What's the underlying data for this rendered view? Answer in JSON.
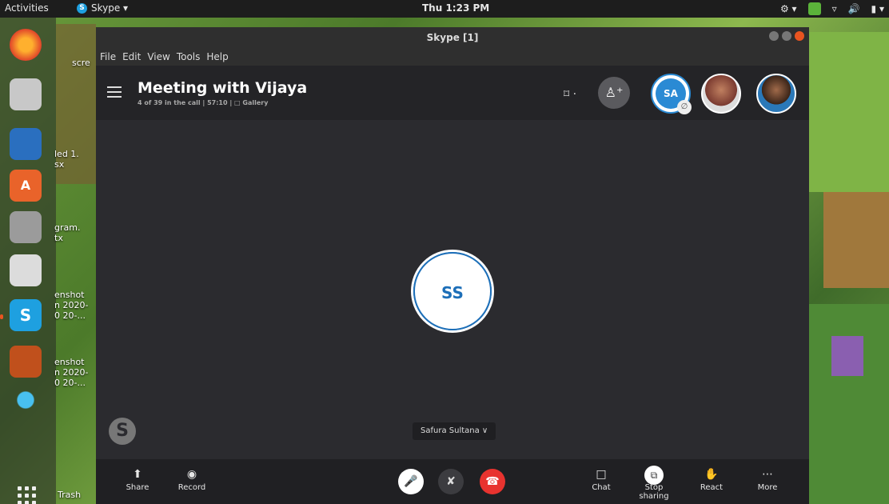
{
  "topbar": {
    "activities": "Activities",
    "app_name": "Skype ▾",
    "clock": "Thu  1:23 PM"
  },
  "desktop_files": [
    {
      "label": "scre"
    },
    {
      "label": "led 1.\nsx"
    },
    {
      "label": "gram.\ntx"
    },
    {
      "label": "enshot\nn 2020-\n0 20-..."
    },
    {
      "label": "enshot\nn 2020-\n0 20-..."
    }
  ],
  "dock_trash_label": "Trash",
  "window": {
    "title": "Skype [1]",
    "menu": [
      "File",
      "Edit",
      "View",
      "Tools",
      "Help"
    ]
  },
  "call": {
    "title": "Meeting with Vijaya",
    "subtitle": "4 of 39 in the call | 57:10 | □ Gallery",
    "self_initials": "SA",
    "center_initials": "SS",
    "speaker_name": "Safura Sultana ∨"
  },
  "toolbar": {
    "share": "Share",
    "record": "Record",
    "chat": "Chat",
    "stop_sharing": "Stop sharing",
    "react": "React",
    "more": "More"
  },
  "icons": {
    "mic": "microphone-icon",
    "video_off": "video-off-icon",
    "end_call": "end-call-icon"
  },
  "colors": {
    "skype_blue": "#1d6fb8",
    "end_call_red": "#e8332f",
    "ubuntu_orange": "#e95420"
  }
}
